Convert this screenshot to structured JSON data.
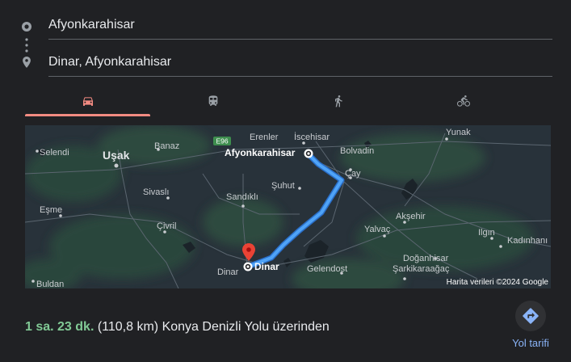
{
  "route": {
    "origin": "Afyonkarahisar",
    "destination": "Dinar, Afyonkarahisar"
  },
  "modes": [
    {
      "name": "car-icon",
      "active": true
    },
    {
      "name": "train-icon",
      "active": false
    },
    {
      "name": "walk-icon",
      "active": false
    },
    {
      "name": "bike-icon",
      "active": false
    }
  ],
  "map": {
    "road_badge": "E96",
    "places": {
      "yunak": "Yunak",
      "selendi": "Selendi",
      "usak": "Uşak",
      "banaz": "Banaz",
      "erenler": "Erenler",
      "iscehisar": "İscehisar",
      "afyon": "Afyonkarahisar",
      "bolvadin": "Bolvadin",
      "cay": "Çay",
      "sivasli": "Sivaslı",
      "sandikli": "Sandıklı",
      "suhut": "Şuhut",
      "esme": "Eşme",
      "aksehir": "Akşehir",
      "civril": "Çivril",
      "yalvac": "Yalvaç",
      "ilgin": "Ilgın",
      "kadinhani": "Kadınhanı",
      "gelendost": "Gelendost",
      "dogansehir": "Doğanhisar",
      "dinar_small": "Dinar",
      "dinar": "Dinar",
      "sarkikaraagac": "Şarkikaraağaç",
      "buldan": "Buldan"
    },
    "attribution": "Harita verileri ©2024 Google"
  },
  "summary": {
    "duration": "1 sa. 23 dk.",
    "details": "(110,8 km) Konya Denizli Yolu üzerinden"
  },
  "directions_label": "Yol tarifi",
  "colors": {
    "accent": "#f28b82",
    "route": "#4fa3f7",
    "duration": "#81c995",
    "link": "#8ab4f8"
  }
}
